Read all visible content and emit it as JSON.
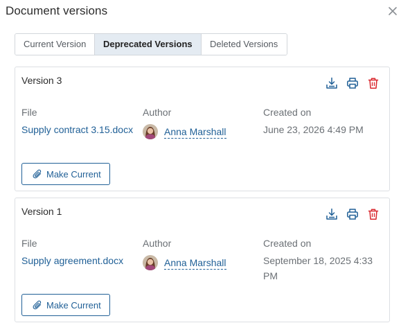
{
  "dialog": {
    "title": "Document versions",
    "close_icon": "close-icon"
  },
  "tabs": [
    {
      "label": "Current Version",
      "active": false
    },
    {
      "label": "Deprecated Versions",
      "active": true
    },
    {
      "label": "Deleted Versions",
      "active": false
    }
  ],
  "labels": {
    "file": "File",
    "author": "Author",
    "created_on": "Created on",
    "make_current": "Make Current"
  },
  "versions": [
    {
      "title": "Version 3",
      "file_name": "Supply contract 3.15.docx",
      "author": "Anna Marshall",
      "created_on": "June 23, 2026 4:49 PM"
    },
    {
      "title": "Version 1",
      "file_name": "Supply agreement.docx",
      "author": "Anna Marshall",
      "created_on": "September 18, 2025 4:33 PM"
    }
  ],
  "icons": {
    "download": "download-icon",
    "print": "printer-icon",
    "delete": "trash-icon",
    "attach": "paperclip-icon"
  },
  "colors": {
    "link": "#1f5f96",
    "delete": "#d9272e",
    "active_tab_bg": "#e4ebf2"
  }
}
